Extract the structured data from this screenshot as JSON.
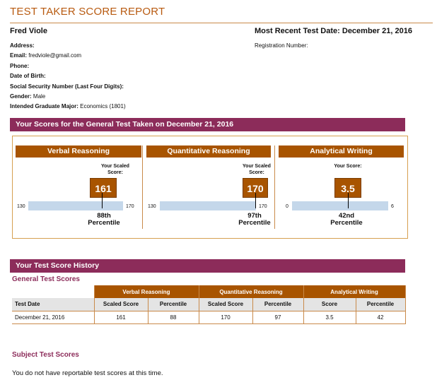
{
  "header": {
    "title": "TEST TAKER SCORE REPORT",
    "name": "Fred Viole",
    "recent_date": "Most Recent Test Date: December 21, 2016",
    "registration_label": "Registration Number:"
  },
  "info": [
    {
      "label": "Address:",
      "value": ""
    },
    {
      "label": "Email:",
      "value": "fredviole@gmail.com"
    },
    {
      "label": "Phone:",
      "value": ""
    },
    {
      "label": "Date of Birth:",
      "value": ""
    },
    {
      "label": "Social Security Number (Last Four Digits):",
      "value": ""
    },
    {
      "label": "Gender:",
      "value": "Male"
    },
    {
      "label": "Intended Graduate Major:",
      "value": "Economics (1801)"
    }
  ],
  "scores_section": {
    "title": "Your Scores for the General Test Taken on December 21, 2016",
    "panels": [
      {
        "heading": "Verbal Reasoning",
        "scaled_label": "Your Scaled Score:",
        "score": "161",
        "min": "130",
        "max": "170",
        "score_fraction": 0.775,
        "percentile": "88th",
        "percentile_word": "Percentile"
      },
      {
        "heading": "Quantitative Reasoning",
        "scaled_label": "Your Scaled Score:",
        "score": "170",
        "min": "130",
        "max": "170",
        "score_fraction": 1.0,
        "percentile": "97th",
        "percentile_word": "Percentile"
      },
      {
        "heading": "Analytical Writing",
        "scaled_label": "Your Score:",
        "score": "3.5",
        "min": "0",
        "max": "6",
        "score_fraction": 0.583,
        "percentile": "42nd",
        "percentile_word": "Percentile"
      }
    ]
  },
  "history": {
    "title": "Your Test Score History",
    "general_heading": "General Test Scores",
    "group_headers": [
      "Verbal Reasoning",
      "Quantitative Reasoning",
      "Analytical Writing"
    ],
    "columns": [
      "Test Date",
      "Scaled Score",
      "Percentile",
      "Scaled Score",
      "Percentile",
      "Score",
      "Percentile"
    ],
    "rows": [
      [
        "December 21, 2016",
        "161",
        "88",
        "170",
        "97",
        "3.5",
        "42"
      ]
    ],
    "subject_heading": "Subject Test Scores",
    "subject_message": "You do not have reportable test scores at this time."
  },
  "colors": {
    "accent": "#a85400",
    "section_bar": "#8c2c5a",
    "track": "#c4d7ea",
    "title": "#b85a10"
  }
}
